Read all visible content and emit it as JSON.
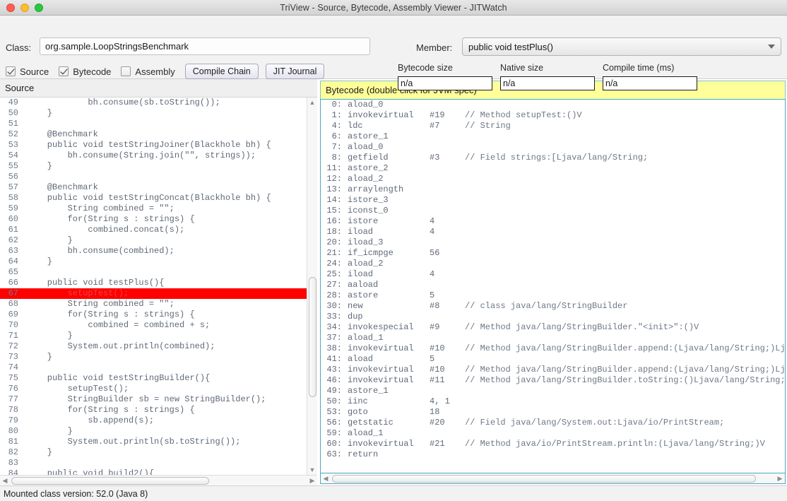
{
  "window": {
    "title": "TriView - Source, Bytecode, Assembly Viewer - JITWatch",
    "controls": {
      "close": "close",
      "minimize": "minimize",
      "maximize": "maximize"
    }
  },
  "toolbar": {
    "class_label": "Class:",
    "class_value": "org.sample.LoopStringsBenchmark",
    "class_placeholder": "",
    "checkboxes": [
      {
        "label": "Source",
        "checked": true
      },
      {
        "label": "Bytecode",
        "checked": true
      },
      {
        "label": "Assembly",
        "checked": false
      }
    ],
    "buttons": [
      {
        "label": "Compile Chain"
      },
      {
        "label": "JIT Journal"
      }
    ],
    "member_label": "Member:",
    "member_value": "public void testPlus()",
    "metrics": [
      {
        "label": "Bytecode size",
        "value": "n/a"
      },
      {
        "label": "Native size",
        "value": "n/a"
      },
      {
        "label": "Compile time (ms)",
        "value": "n/a"
      }
    ]
  },
  "source_panel": {
    "header": "Source",
    "highlight_line": 67,
    "lines": [
      {
        "n": 49,
        "text": "            bh.consume(sb.toString());"
      },
      {
        "n": 50,
        "text": "    }"
      },
      {
        "n": 51,
        "text": ""
      },
      {
        "n": 52,
        "text": "    @Benchmark"
      },
      {
        "n": 53,
        "text": "    public void testStringJoiner(Blackhole bh) {"
      },
      {
        "n": 54,
        "text": "        bh.consume(String.join(\"\", strings));"
      },
      {
        "n": 55,
        "text": "    }"
      },
      {
        "n": 56,
        "text": ""
      },
      {
        "n": 57,
        "text": "    @Benchmark"
      },
      {
        "n": 58,
        "text": "    public void testStringConcat(Blackhole bh) {"
      },
      {
        "n": 59,
        "text": "        String combined = \"\";"
      },
      {
        "n": 60,
        "text": "        for(String s : strings) {"
      },
      {
        "n": 61,
        "text": "            combined.concat(s);"
      },
      {
        "n": 62,
        "text": "        }"
      },
      {
        "n": 63,
        "text": "        bh.consume(combined);"
      },
      {
        "n": 64,
        "text": "    }"
      },
      {
        "n": 65,
        "text": ""
      },
      {
        "n": 66,
        "text": "    public void testPlus(){"
      },
      {
        "n": 67,
        "text": "        setupTest();"
      },
      {
        "n": 68,
        "text": "        String combined = \"\";"
      },
      {
        "n": 69,
        "text": "        for(String s : strings) {"
      },
      {
        "n": 70,
        "text": "            combined = combined + s;"
      },
      {
        "n": 71,
        "text": "        }"
      },
      {
        "n": 72,
        "text": "        System.out.println(combined);"
      },
      {
        "n": 73,
        "text": "    }"
      },
      {
        "n": 74,
        "text": ""
      },
      {
        "n": 75,
        "text": "    public void testStringBuilder(){"
      },
      {
        "n": 76,
        "text": "        setupTest();"
      },
      {
        "n": 77,
        "text": "        StringBuilder sb = new StringBuilder();"
      },
      {
        "n": 78,
        "text": "        for(String s : strings) {"
      },
      {
        "n": 79,
        "text": "            sb.append(s);"
      },
      {
        "n": 80,
        "text": "        }"
      },
      {
        "n": 81,
        "text": "        System.out.println(sb.toString());"
      },
      {
        "n": 82,
        "text": "    }"
      },
      {
        "n": 83,
        "text": ""
      },
      {
        "n": 84,
        "text": "    public void build2(){"
      }
    ]
  },
  "bytecode_panel": {
    "header": "Bytecode (double click for JVM spec)",
    "lines": [
      {
        "offset": "0:",
        "op": "aload_0",
        "arg": "",
        "comment": ""
      },
      {
        "offset": "1:",
        "op": "invokevirtual",
        "arg": "#19",
        "comment": "// Method setupTest:()V"
      },
      {
        "offset": "4:",
        "op": "ldc",
        "arg": "#7",
        "comment": "// String"
      },
      {
        "offset": "6:",
        "op": "astore_1",
        "arg": "",
        "comment": ""
      },
      {
        "offset": "7:",
        "op": "aload_0",
        "arg": "",
        "comment": ""
      },
      {
        "offset": "8:",
        "op": "getfield",
        "arg": "#3",
        "comment": "// Field strings:[Ljava/lang/String;"
      },
      {
        "offset": "11:",
        "op": "astore_2",
        "arg": "",
        "comment": ""
      },
      {
        "offset": "12:",
        "op": "aload_2",
        "arg": "",
        "comment": ""
      },
      {
        "offset": "13:",
        "op": "arraylength",
        "arg": "",
        "comment": ""
      },
      {
        "offset": "14:",
        "op": "istore_3",
        "arg": "",
        "comment": ""
      },
      {
        "offset": "15:",
        "op": "iconst_0",
        "arg": "",
        "comment": ""
      },
      {
        "offset": "16:",
        "op": "istore",
        "arg": "4",
        "comment": ""
      },
      {
        "offset": "18:",
        "op": "iload",
        "arg": "4",
        "comment": ""
      },
      {
        "offset": "20:",
        "op": "iload_3",
        "arg": "",
        "comment": ""
      },
      {
        "offset": "21:",
        "op": "if_icmpge",
        "arg": "56",
        "comment": ""
      },
      {
        "offset": "24:",
        "op": "aload_2",
        "arg": "",
        "comment": ""
      },
      {
        "offset": "25:",
        "op": "iload",
        "arg": "4",
        "comment": ""
      },
      {
        "offset": "27:",
        "op": "aaload",
        "arg": "",
        "comment": ""
      },
      {
        "offset": "28:",
        "op": "astore",
        "arg": "5",
        "comment": ""
      },
      {
        "offset": "30:",
        "op": "new",
        "arg": "#8",
        "comment": "// class java/lang/StringBuilder"
      },
      {
        "offset": "33:",
        "op": "dup",
        "arg": "",
        "comment": ""
      },
      {
        "offset": "34:",
        "op": "invokespecial",
        "arg": "#9",
        "comment": "// Method java/lang/StringBuilder.\"<init>\":()V"
      },
      {
        "offset": "37:",
        "op": "aload_1",
        "arg": "",
        "comment": ""
      },
      {
        "offset": "38:",
        "op": "invokevirtual",
        "arg": "#10",
        "comment": "// Method java/lang/StringBuilder.append:(Ljava/lang/String;)Ljava"
      },
      {
        "offset": "41:",
        "op": "aload",
        "arg": "5",
        "comment": ""
      },
      {
        "offset": "43:",
        "op": "invokevirtual",
        "arg": "#10",
        "comment": "// Method java/lang/StringBuilder.append:(Ljava/lang/String;)Ljava"
      },
      {
        "offset": "46:",
        "op": "invokevirtual",
        "arg": "#11",
        "comment": "// Method java/lang/StringBuilder.toString:()Ljava/lang/String;"
      },
      {
        "offset": "49:",
        "op": "astore_1",
        "arg": "",
        "comment": ""
      },
      {
        "offset": "50:",
        "op": "iinc",
        "arg": "4, 1",
        "comment": ""
      },
      {
        "offset": "53:",
        "op": "goto",
        "arg": "18",
        "comment": ""
      },
      {
        "offset": "56:",
        "op": "getstatic",
        "arg": "#20",
        "comment": "// Field java/lang/System.out:Ljava/io/PrintStream;"
      },
      {
        "offset": "59:",
        "op": "aload_1",
        "arg": "",
        "comment": ""
      },
      {
        "offset": "60:",
        "op": "invokevirtual",
        "arg": "#21",
        "comment": "// Method java/io/PrintStream.println:(Ljava/lang/String;)V"
      },
      {
        "offset": "63:",
        "op": "return",
        "arg": "",
        "comment": ""
      }
    ]
  },
  "statusbar": {
    "text": "Mounted class version: 52.0 (Java 8)"
  },
  "colors": {
    "highlight": "#ff0000",
    "bytecode_header_bg": "#ffff99",
    "bytecode_border": "#4aa8c8",
    "window_chrome": "#f2f2f2"
  }
}
